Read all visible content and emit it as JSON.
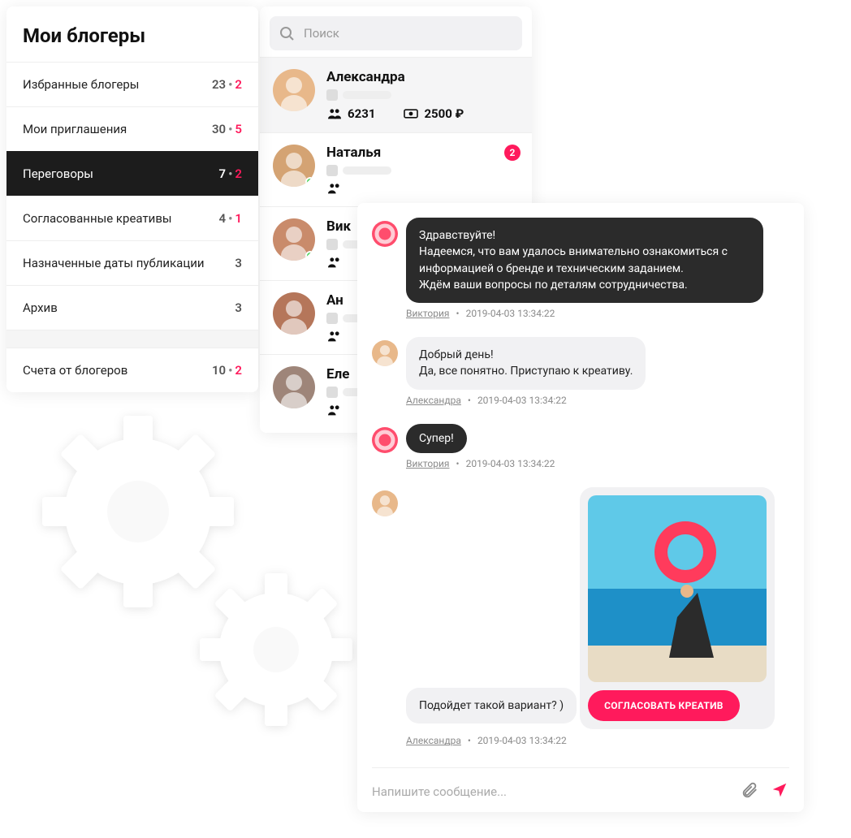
{
  "sidebar": {
    "title": "Мои блогеры",
    "items": [
      {
        "label": "Избранные блогеры",
        "c1": "23",
        "c2": "2"
      },
      {
        "label": "Мои приглашения",
        "c1": "30",
        "c2": "5"
      },
      {
        "label": "Переговоры",
        "c1": "7",
        "c2": "2",
        "active": true
      },
      {
        "label": "Согласованные креативы",
        "c1": "4",
        "c2": "1"
      },
      {
        "label": "Назначенные даты публикации",
        "c1": "3"
      },
      {
        "label": "Архив",
        "c1": "3"
      }
    ],
    "footer": {
      "label": "Счета от блогеров",
      "c1": "10",
      "c2": "2"
    }
  },
  "search": {
    "placeholder": "Поиск"
  },
  "bloggers": [
    {
      "name": "Александра",
      "followers": "6231",
      "price": "2500 ₽",
      "selected": true
    },
    {
      "name": "Наталья",
      "badge": "2",
      "online": true
    },
    {
      "name": "Вик",
      "online": true
    },
    {
      "name": "Ан"
    },
    {
      "name": "Еле"
    }
  ],
  "chat": {
    "messages": [
      {
        "type": "dark",
        "avatar": "ring",
        "lines": [
          "Здравствуйте!",
          "Надеемся, что вам удалось внимательно ознакомиться с информацией о бренде и техническим заданием.",
          "Ждём ваши вопросы по деталям сотрудничества."
        ],
        "author": "Виктория",
        "ts": "2019-04-03 13:34:22"
      },
      {
        "type": "light",
        "avatar": "alex",
        "lines": [
          "Добрый день!",
          "Да, все понятно. Приступаю к креативу."
        ],
        "author": "Александра",
        "ts": "2019-04-03 13:34:22"
      },
      {
        "type": "dark2",
        "avatar": "ring",
        "text": "Супер!",
        "author": "Виктория",
        "ts": "2019-04-03 13:34:22"
      },
      {
        "type": "creative",
        "avatar": "alex",
        "text": "Подойдет такой вариант? )",
        "button": "СОГЛАСОВАТЬ КРЕАТИВ",
        "author": "Александра",
        "ts": "2019-04-03 13:34:22"
      }
    ],
    "composer_placeholder": "Напишите сообщение..."
  }
}
